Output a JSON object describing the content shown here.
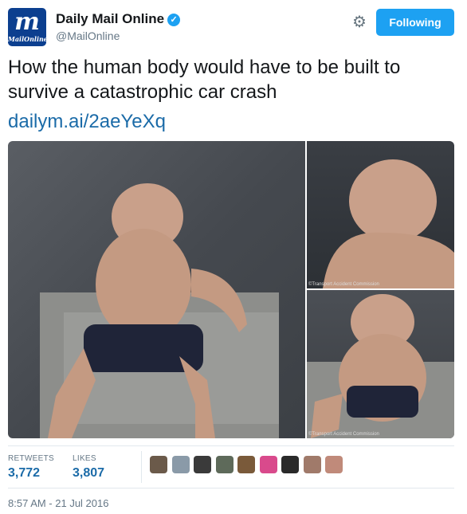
{
  "header": {
    "logo_mark": "m",
    "logo_word": "MailOnline",
    "name": "Daily Mail Online",
    "handle": "@MailOnline",
    "follow_label": "Following",
    "settings_icon": "gear-icon",
    "verified_icon": "verified-badge-icon"
  },
  "tweet": {
    "text": "How the human body would have to be built to survive a catastrophic car crash",
    "link": "dailym.ai/2aeYeXq"
  },
  "media": {
    "caption_top_right": "©Transport Accident Commission",
    "caption_bottom_right": "©Transport Accident Commission"
  },
  "stats": {
    "retweets_label": "RETWEETS",
    "retweets_value": "3,772",
    "likes_label": "LIKES",
    "likes_value": "3,807"
  },
  "avatars": [
    "#6b5a4a",
    "#8a9aa8",
    "#3a3a3a",
    "#5e6a5a",
    "#7a5a3a",
    "#d94a8c",
    "#2a2a2a",
    "#a07a6a",
    "#c08a7a"
  ],
  "timestamp": "8:57 AM - 21 Jul 2016",
  "colors": {
    "accent": "#1da1f2",
    "link": "#1b6ba8",
    "brand": "#0c3f8f"
  }
}
